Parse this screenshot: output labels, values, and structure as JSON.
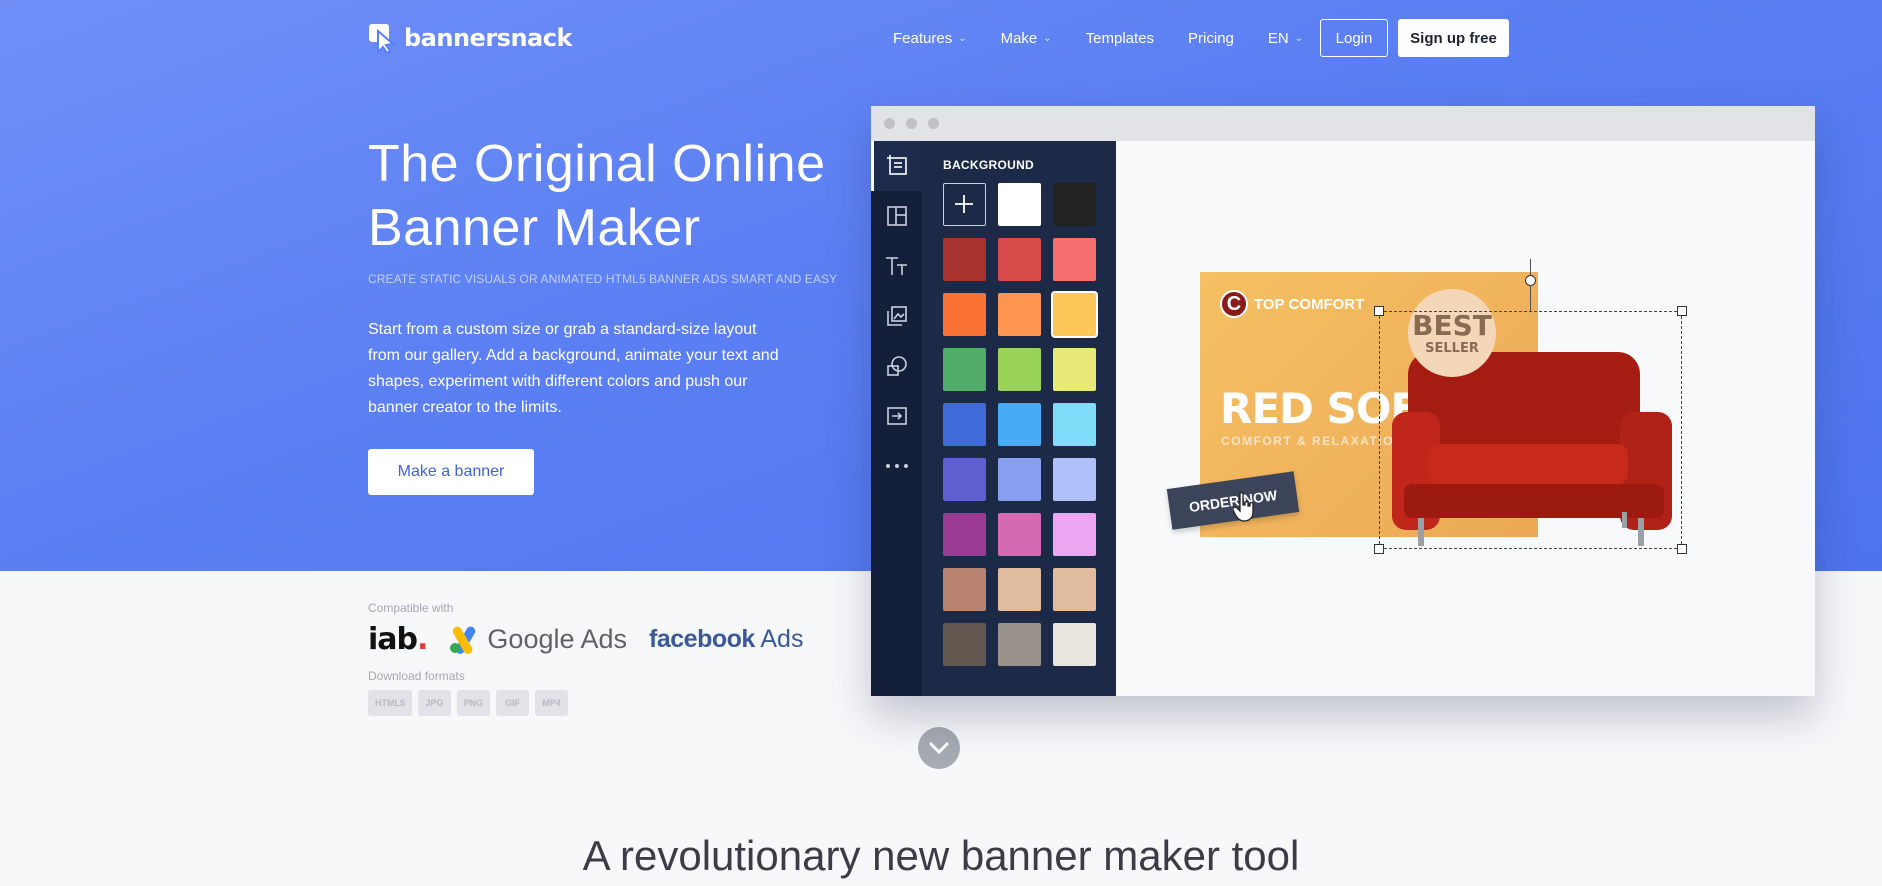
{
  "brand": {
    "name": "bannersnack"
  },
  "nav": {
    "items": [
      {
        "label": "Features",
        "dropdown": true
      },
      {
        "label": "Make",
        "dropdown": true
      },
      {
        "label": "Templates",
        "dropdown": false
      },
      {
        "label": "Pricing",
        "dropdown": false
      },
      {
        "label": "EN",
        "dropdown": true
      }
    ],
    "login": "Login",
    "signup": "Sign up free"
  },
  "hero": {
    "title": "The Original Online Banner Maker",
    "subtitle": "CREATE STATIC VISUALS OR ANIMATED HTML5 BANNER ADS SMART AND EASY",
    "description": "Start from a custom size or grab a standard-size layout from our gallery. Add a background, animate your text and shapes, experiment with different colors and push our banner creator to the limits.",
    "cta": "Make a banner"
  },
  "compatibility": {
    "label": "Compatible with",
    "partners": {
      "iab": "iab",
      "iab_dot": ".",
      "google": "Google Ads",
      "facebook_brand": "facebook",
      "facebook_suffix": "Ads"
    }
  },
  "downloads": {
    "label": "Download formats",
    "formats": [
      "HTML5",
      "JPG",
      "PNG",
      "GIF",
      "MP4"
    ]
  },
  "editor": {
    "panel_title": "BACKGROUND",
    "tools": [
      "layout-icon",
      "templates-icon",
      "text-icon",
      "images-icon",
      "shapes-icon",
      "export-icon",
      "more-icon"
    ],
    "swatches": [
      "add",
      "#ffffff",
      "#222222",
      "#a8322d",
      "#d94c4c",
      "#f56f6f",
      "#fb7334",
      "#fd9550",
      "#fdc859",
      "#52ac69",
      "#9ad359",
      "#e8ea77",
      "#3f6bd9",
      "#48acf4",
      "#7fdcf8",
      "#5f60cf",
      "#86a0ef",
      "#b0c0fa",
      "#9b3b96",
      "#d569b4",
      "#eca6f1",
      "#b7836f",
      "#e0bb9e",
      "#e0bb9e",
      "#625850",
      "#9a938c",
      "#e8e6df"
    ],
    "selected_swatch": 8,
    "banner": {
      "brand_letter": "C",
      "brand": "TOP COMFORT",
      "headline": "RED SOFA",
      "tagline": "COMFORT & RELAXATION",
      "badge_line1": "BEST",
      "badge_line2": "SELLER",
      "cta": "ORDER NOW"
    }
  },
  "section": {
    "heading": "A revolutionary new banner maker tool"
  }
}
